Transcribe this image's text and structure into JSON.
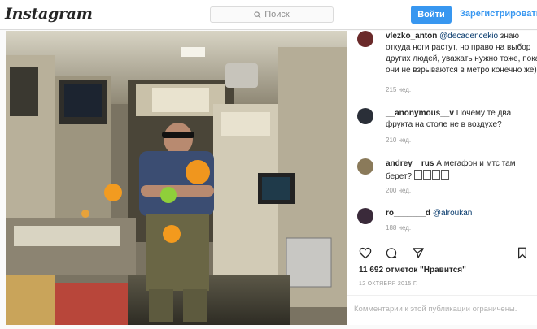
{
  "header": {
    "logo_text": "Instagram",
    "search_placeholder": "Поиск",
    "login_label": "Войти",
    "register_label": "Зарегистрироваться"
  },
  "post": {
    "comments": [
      {
        "username": "vlezko_anton",
        "mention": "@decadencekio",
        "text": "знаю откуда ноги растут, но право на выбор других людей, уважать нужно тоже, пока они не взрываются в метро конечно же)",
        "time": "215 нед."
      },
      {
        "username": "__anonymous__v",
        "text": "Почему те два фрукта на столе не в воздухе?",
        "time": "210 нед."
      },
      {
        "username": "andrey__rus",
        "text": "А мегафон и мтс там берет?",
        "time": "200 нед."
      },
      {
        "username": "ro_______d",
        "mention": "@alroukan",
        "text": "",
        "time": "188 нед."
      }
    ],
    "likes": "11 692 отметок \"Нравится\"",
    "date": "12 ОКТЯБРЯ 2015 Г.",
    "comments_closed": "Комментарии к этой публикации ограничены."
  },
  "colors": {
    "accent": "#3897f0",
    "border": "#dbdbdb",
    "muted": "#999999"
  },
  "icons": [
    "instagram-camera-icon",
    "search-icon",
    "heart-icon",
    "comment-icon",
    "share-icon",
    "bookmark-icon"
  ]
}
